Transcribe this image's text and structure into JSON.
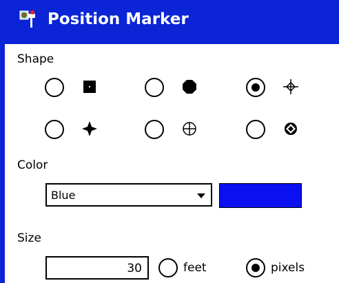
{
  "window": {
    "title": "Position Marker",
    "icon": "globe-pin-icon",
    "accent": "#0a24d6"
  },
  "shape": {
    "label": "Shape",
    "options": [
      {
        "icon": "filled-square-icon",
        "selected": false
      },
      {
        "icon": "filled-octagon-icon",
        "selected": false
      },
      {
        "icon": "crosshair-diamond-icon",
        "selected": true
      },
      {
        "icon": "four-point-star-icon",
        "selected": false
      },
      {
        "icon": "circle-cross-icon",
        "selected": false
      },
      {
        "icon": "circled-diamond-icon",
        "selected": false
      }
    ]
  },
  "color": {
    "label": "Color",
    "selected": "Blue",
    "swatch": "#0a10f0"
  },
  "size": {
    "label": "Size",
    "value": "30",
    "units": {
      "feet": "feet",
      "pixels": "pixels",
      "selected": "pixels"
    }
  }
}
